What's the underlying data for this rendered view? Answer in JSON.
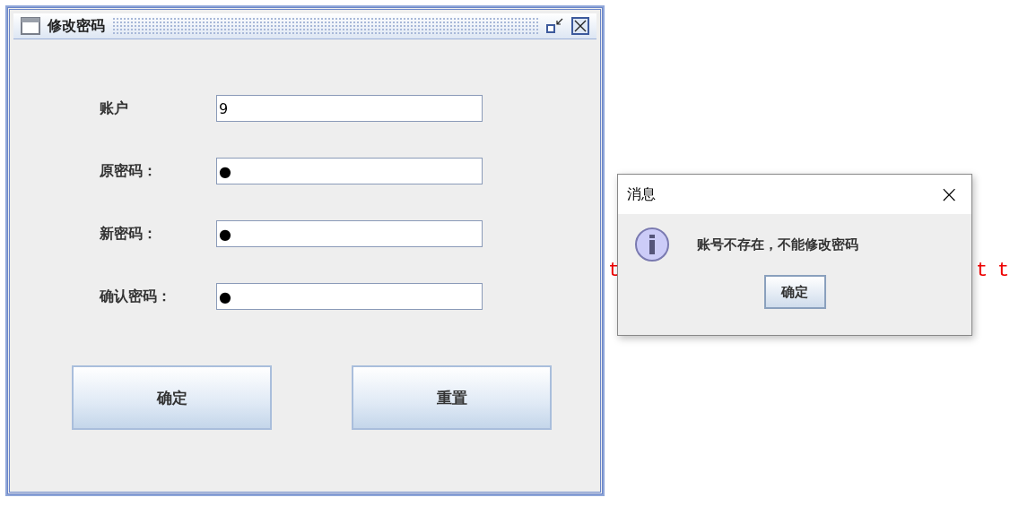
{
  "background_text": [
    {
      "text": "t"
    },
    {
      "text": "t"
    },
    {
      "text": "t"
    }
  ],
  "window": {
    "title": "修改密码"
  },
  "fields": [
    {
      "label": "账户",
      "value": "9"
    },
    {
      "label": "原密码：",
      "value": "●"
    },
    {
      "label": "新密码：",
      "value": "●"
    },
    {
      "label": "确认密码：",
      "value": "●"
    }
  ],
  "buttons": [
    "确定",
    "重置"
  ],
  "dialog": {
    "title": "消息",
    "close": "×",
    "message": "账号不存在，不能修改密码",
    "button": "确定"
  }
}
